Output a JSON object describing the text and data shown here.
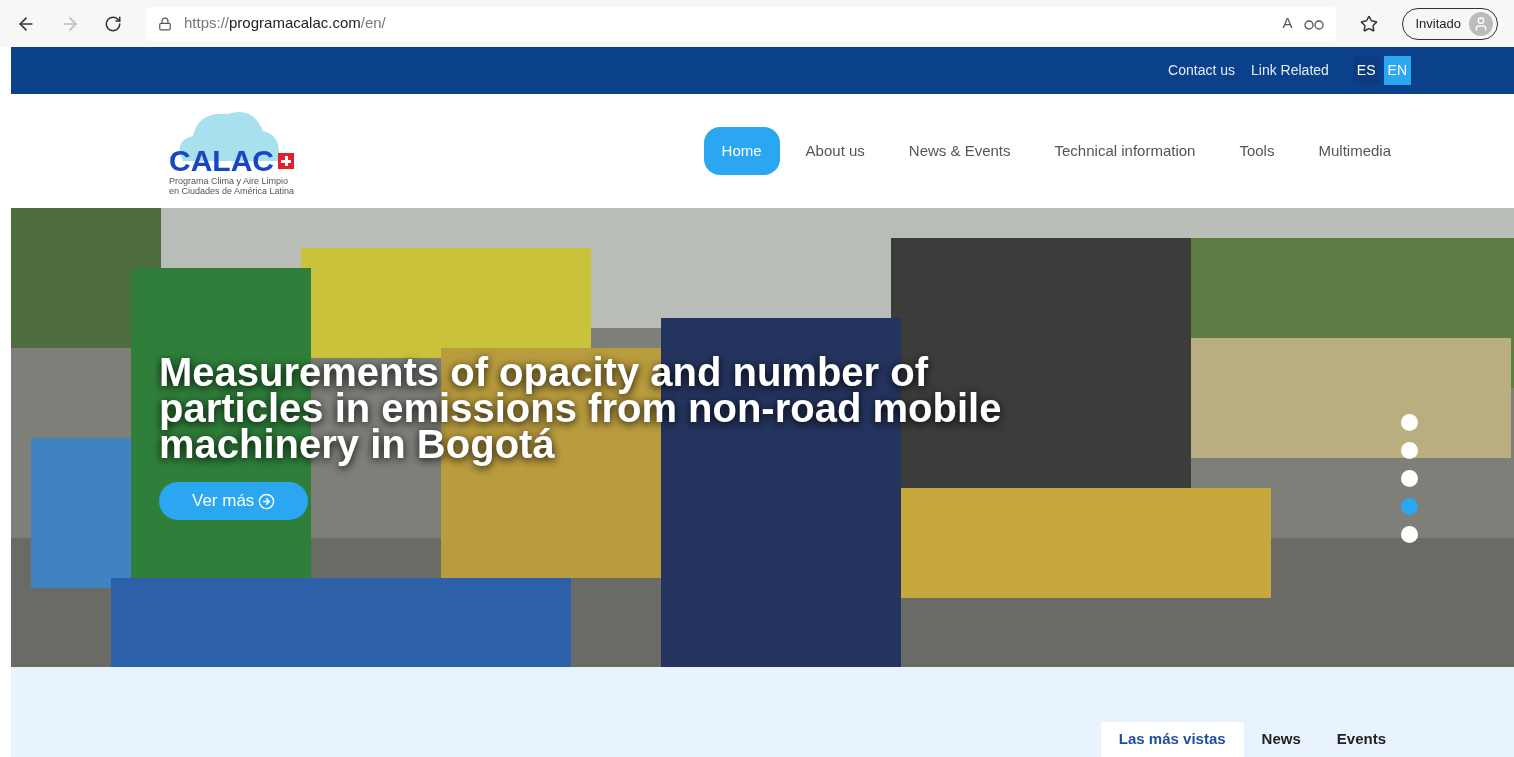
{
  "browser": {
    "url_scheme": "https://",
    "url_host": "programacalac.com",
    "url_path": "/en/",
    "profile": "Invitado",
    "read_aloud": "A"
  },
  "topbar": {
    "links": [
      "Contact us",
      "Link Related"
    ],
    "languages": [
      {
        "label": "ES",
        "selected": false
      },
      {
        "label": "EN",
        "selected": true
      }
    ]
  },
  "logo": {
    "name": "CALAC",
    "tagline": [
      "Programa Clima y Aire Limpio",
      "en Ciudades de América Latina"
    ]
  },
  "nav": [
    {
      "label": "Home",
      "selected": true
    },
    {
      "label": "About us",
      "selected": false
    },
    {
      "label": "News & Events",
      "selected": false
    },
    {
      "label": "Technical information",
      "selected": false
    },
    {
      "label": "Tools",
      "selected": false
    },
    {
      "label": "Multimedia",
      "selected": false
    }
  ],
  "hero": {
    "title": "Measurements of opacity and number of particles in emissions from non-road mobile machinery in Bogotá",
    "button": "Ver más",
    "slides": [
      {
        "selected": false
      },
      {
        "selected": false
      },
      {
        "selected": false
      },
      {
        "selected": true
      },
      {
        "selected": false
      }
    ]
  },
  "tabs": [
    {
      "label": "Las más vistas",
      "selected": true
    },
    {
      "label": "News",
      "selected": false
    },
    {
      "label": "Events",
      "selected": false
    }
  ]
}
